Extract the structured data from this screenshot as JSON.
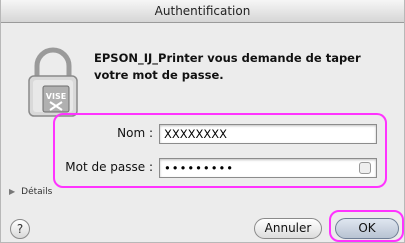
{
  "window": {
    "title": "Authentification"
  },
  "dialog": {
    "message": "EPSON_IJ_Printer vous demande de taper votre mot de passe.",
    "lock_badge": "VISE",
    "name_label": "Nom :",
    "name_value": "XXXXXXXX",
    "password_label": "Mot de passe :",
    "password_value": "•••••••••",
    "details_label": "Détails",
    "help_label": "?",
    "cancel_label": "Annuler",
    "ok_label": "OK"
  },
  "colors": {
    "highlight": "#ff33ff",
    "window_bg": "#ececec"
  }
}
